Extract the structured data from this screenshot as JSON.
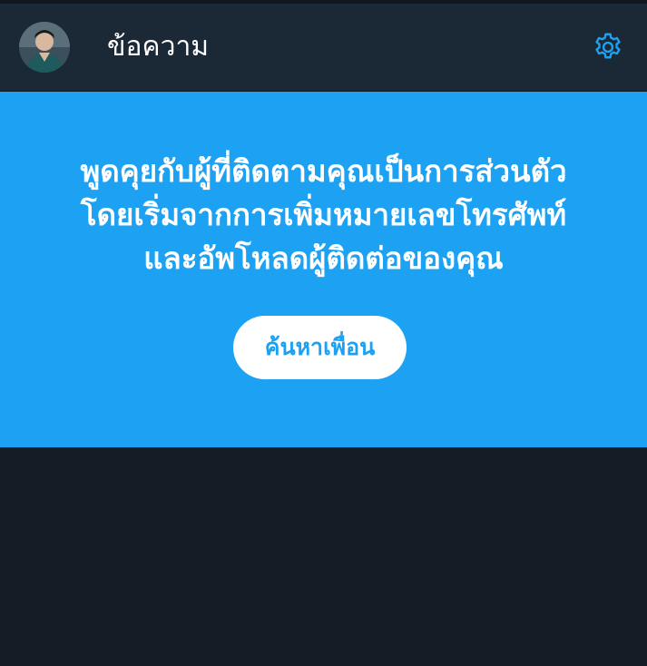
{
  "header": {
    "title": "ข้อความ",
    "avatar_icon": "user-avatar",
    "settings_icon": "gear-icon"
  },
  "promo": {
    "lines": [
      "พูดคุยกับผู้ที่ติดตามคุณเป็นการส่วนตัว",
      "โดยเริ่มจากการเพิ่มหมายเลขโทรศัพท์",
      "และอัพโหลดผู้ติดต่อของคุณ"
    ],
    "button_label": "ค้นหาเพื่อน"
  },
  "colors": {
    "accent": "#1da1f2",
    "header_bg": "#1b2836",
    "page_bg": "#141d26"
  }
}
